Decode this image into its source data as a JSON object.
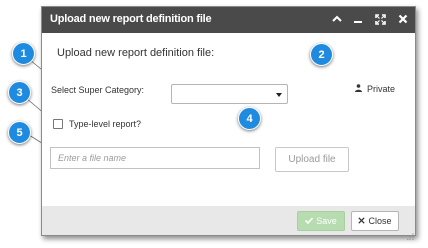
{
  "dialog": {
    "title": "Upload new report definition file",
    "heading": "Upload new report definition file:",
    "super_category_label": "Select Super Category:",
    "super_category_value": "",
    "private_label": "Private",
    "type_level_label": "Type-level report?",
    "file_placeholder": "Enter a file name",
    "upload_label": "Upload file",
    "save_label": "Save",
    "close_label": "Close"
  },
  "titlebar_icons": [
    "chevron-up-icon",
    "minimize-icon",
    "expand-icon",
    "close-icon"
  ],
  "callouts": [
    "1",
    "2",
    "3",
    "4",
    "5"
  ],
  "colors": {
    "titlebar": "#4a4a4a",
    "callout": "#1f8be0",
    "save": "#b6dcb0",
    "footer": "#e8e8e8"
  }
}
